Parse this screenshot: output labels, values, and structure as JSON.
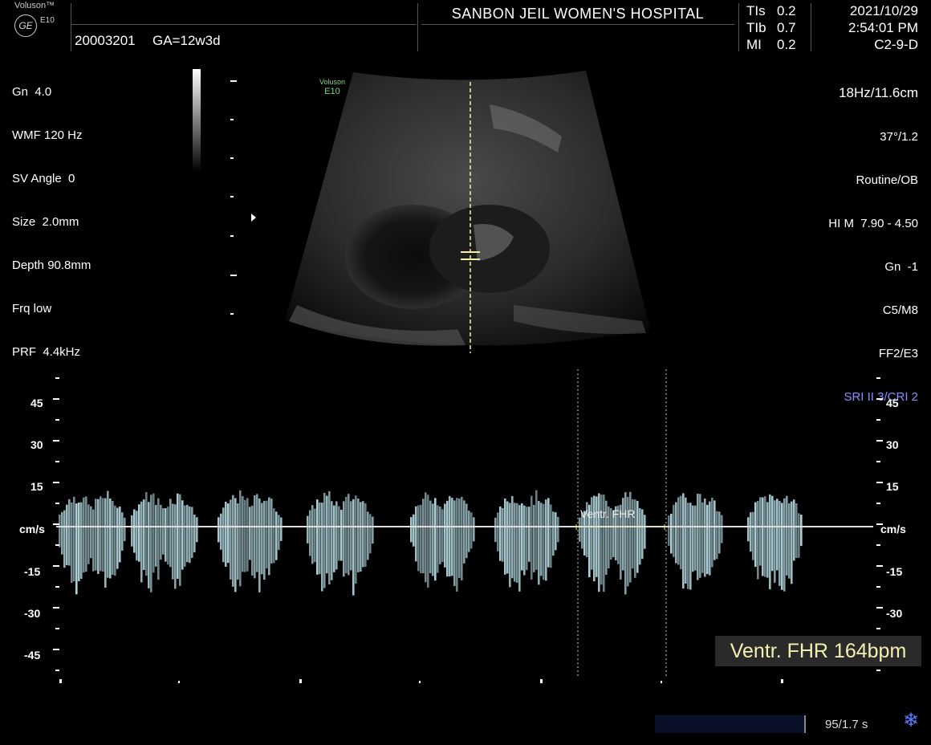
{
  "header": {
    "brand": "Voluson™",
    "brand_model": "E10",
    "logo_text": "GE",
    "hospital": "SANBON JEIL WOMEN'S HOSPITAL",
    "patient_id": "20003201",
    "gestational_age": "GA=12w3d",
    "tis_label": "TIs",
    "tis_value": "0.2",
    "tib_label": "TIb",
    "tib_value": "0.7",
    "mi_label": "MI",
    "mi_value": "0.2",
    "date": "2021/10/29",
    "time": "2:54:01 PM",
    "probe": "C2-9-D"
  },
  "left_params": [
    "Gn  4.0",
    "WMF 120 Hz",
    "SV Angle  0",
    "Size  2.0mm",
    "Depth 90.8mm",
    "Frq low",
    "PRF  4.4kHz"
  ],
  "right_params": [
    "18Hz/11.6cm",
    "37°/1.2",
    "Routine/OB",
    "HI M  7.90 - 4.50",
    "Gn  -1",
    "C5/M8",
    "FF2/E3",
    "SRI II 3/CRI 2"
  ],
  "image_watermark": {
    "line1": "Voluson",
    "line2": "E10"
  },
  "doppler": {
    "unit": "cm/s",
    "scale_labels": [
      "45",
      "30",
      "15",
      "-15",
      "-30",
      "-45"
    ],
    "caliper_label": "Ventr. FHR",
    "measurement": "Ventr. FHR 164bpm"
  },
  "footer": {
    "frame_info": "95/1.7 s",
    "freeze_icon": "snowflake-icon"
  },
  "colors": {
    "accent_green": "#7fd87f",
    "sri_color": "#8a8cff",
    "measurement_text": "#f5f0b0",
    "caliper": "#e8e88a"
  }
}
